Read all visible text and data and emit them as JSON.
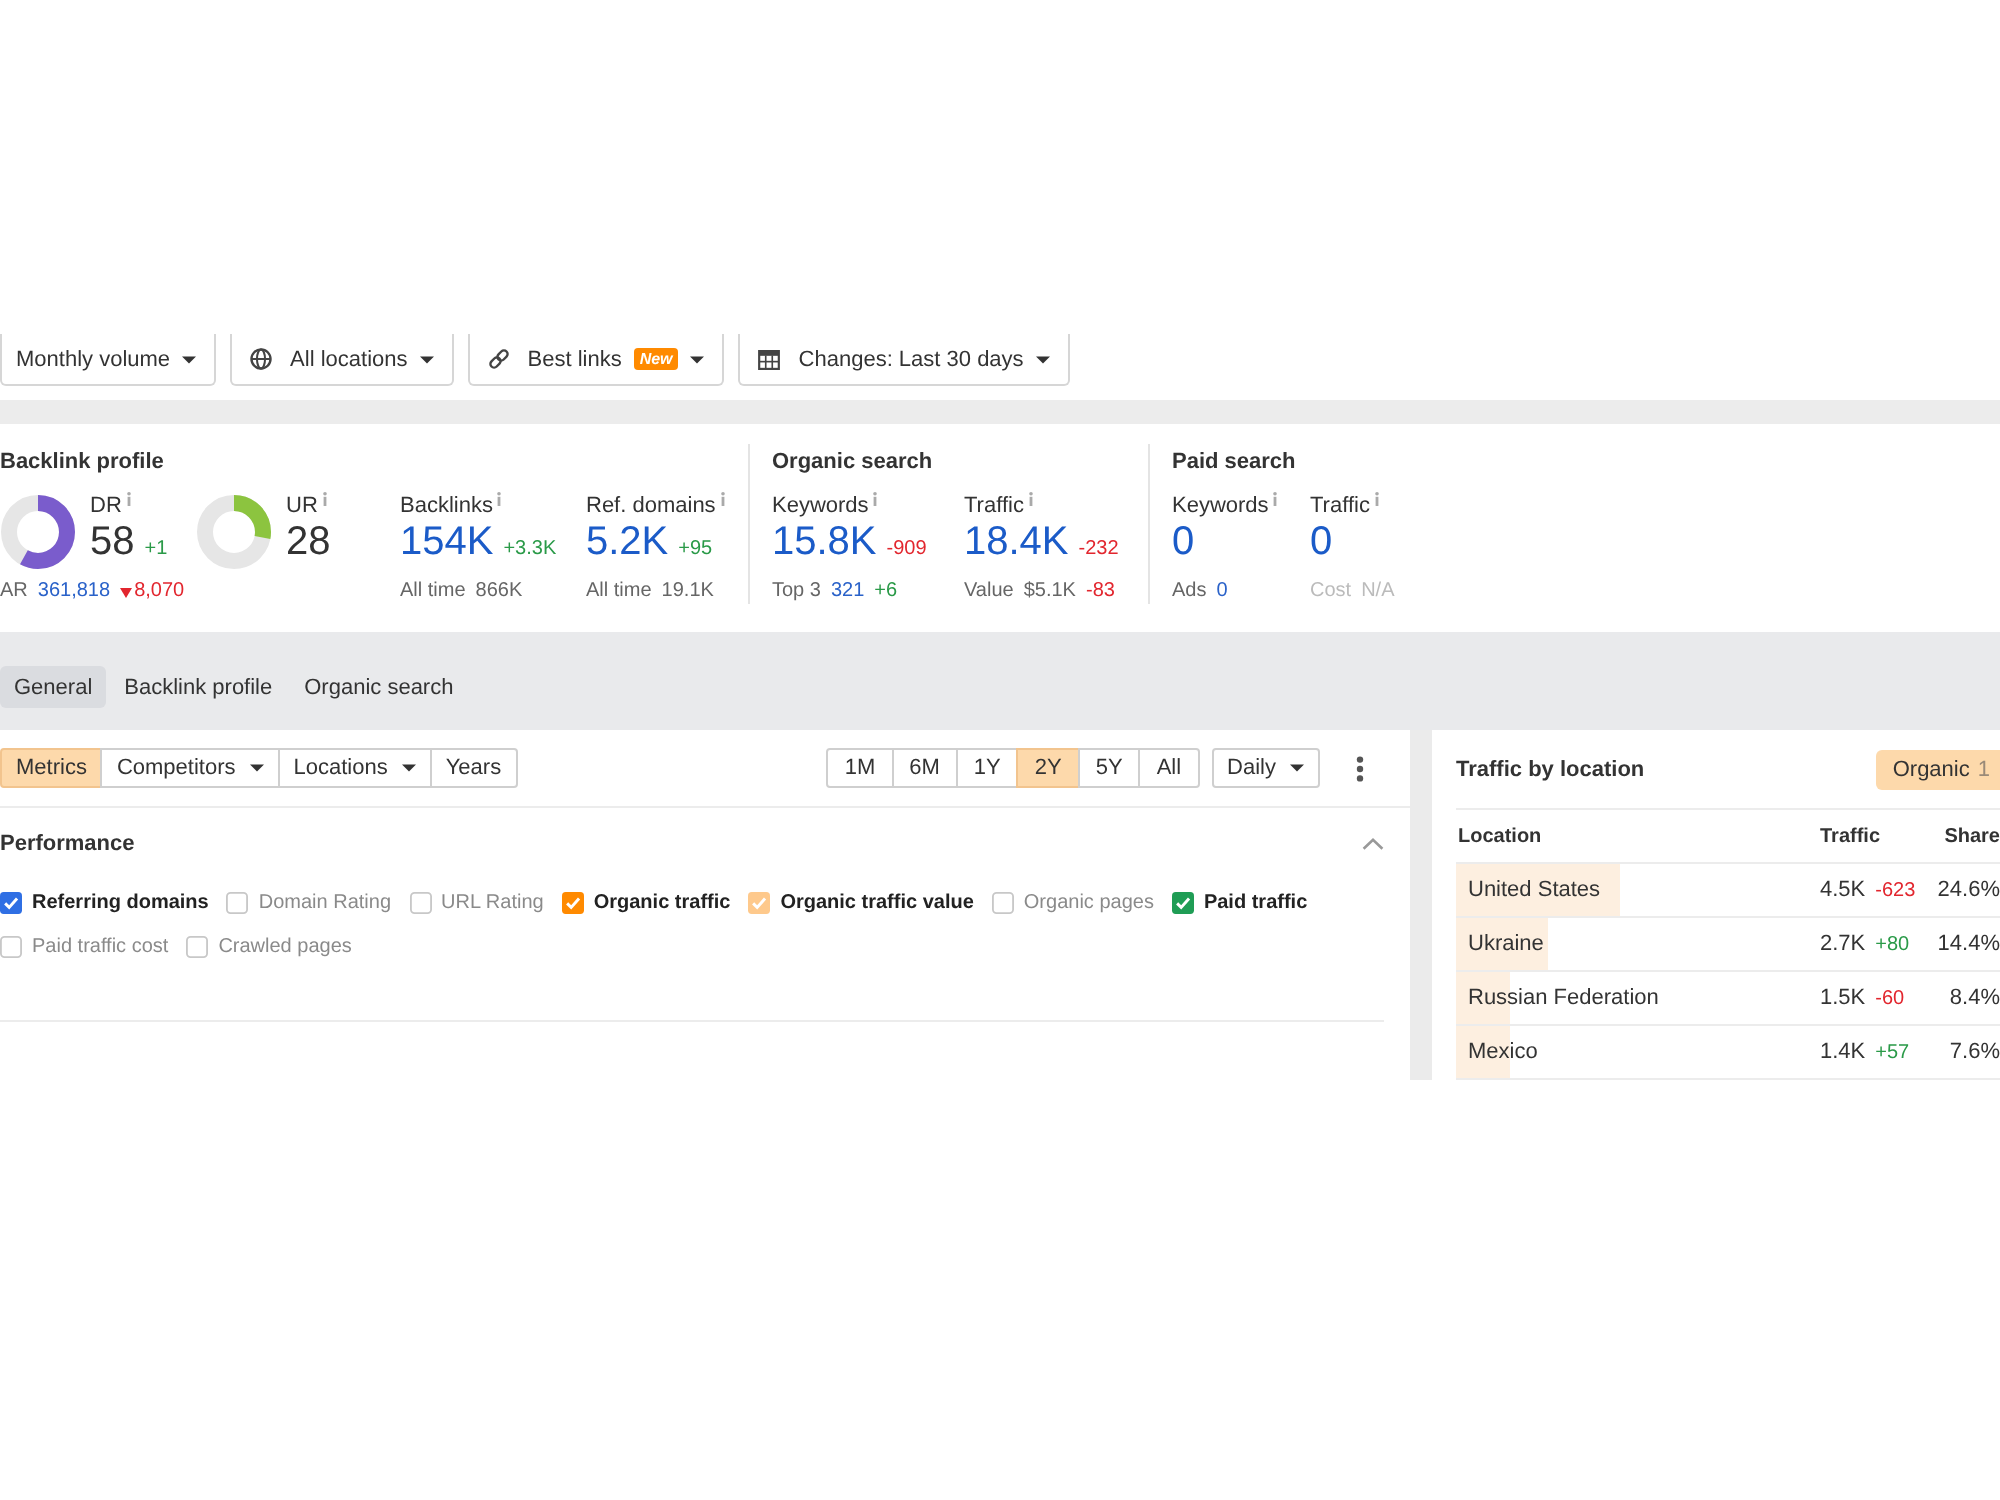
{
  "toolbar": [
    {
      "kind": "plain",
      "label": "Monthly volume"
    },
    {
      "kind": "location",
      "label": "All locations"
    },
    {
      "kind": "links",
      "label": "Best links",
      "badge": "New"
    },
    {
      "kind": "date",
      "label": "Changes: Last 30 days"
    }
  ],
  "overview": [
    {
      "title": "Backlink profile",
      "metrics": [
        {
          "kind": "rating",
          "label": "DR",
          "color": "#7a5ccc",
          "level": 0.58,
          "value": "58",
          "change": "+1",
          "positive": true,
          "details": [
            {
              "kind": "label",
              "text": "AR"
            },
            {
              "kind": "link",
              "text": "361,818"
            },
            {
              "kind": "drop",
              "text": "8,070"
            }
          ]
        },
        {
          "kind": "rating",
          "label": "UR",
          "color": "#8cc43f",
          "level": 0.28,
          "value": "28"
        },
        {
          "kind": "count",
          "label": "Backlinks",
          "value": "154K",
          "change": "+3.3K",
          "positive": true,
          "details": [
            {
              "kind": "label",
              "text": "All time"
            },
            {
              "kind": "label",
              "text": "866K"
            }
          ]
        },
        {
          "kind": "count",
          "label": "Ref. domains",
          "value": "5.2K",
          "change": "+95",
          "positive": true,
          "details": [
            {
              "kind": "label",
              "text": "All time"
            },
            {
              "kind": "label",
              "text": "19.1K"
            }
          ]
        }
      ]
    },
    {
      "title": "Organic search",
      "metrics": [
        {
          "kind": "count",
          "label": "Keywords",
          "value": "15.8K",
          "change": "-909",
          "positive": false,
          "details": [
            {
              "kind": "label",
              "text": "Top 3"
            },
            {
              "kind": "link",
              "text": "321"
            },
            {
              "kind": "up",
              "text": "+6"
            }
          ]
        },
        {
          "kind": "count",
          "label": "Traffic",
          "value": "18.4K",
          "change": "-232",
          "positive": false,
          "details": [
            {
              "kind": "label",
              "text": "Value"
            },
            {
              "kind": "label",
              "text": "$5.1K"
            },
            {
              "kind": "down",
              "text": "-83"
            }
          ]
        }
      ]
    },
    {
      "title": "Paid search",
      "metrics": [
        {
          "kind": "count",
          "label": "Keywords",
          "value": "0",
          "details": [
            {
              "kind": "label",
              "text": "Ads"
            },
            {
              "kind": "link",
              "text": "0"
            }
          ]
        },
        {
          "kind": "count",
          "label": "Traffic",
          "value": "0",
          "details": [
            {
              "kind": "disabled",
              "text": "Cost"
            },
            {
              "kind": "disabled",
              "text": "N/A"
            }
          ]
        }
      ]
    }
  ],
  "tabs": [
    {
      "label": "General",
      "selected": true
    },
    {
      "label": "Backlink profile",
      "selected": false
    },
    {
      "label": "Organic search",
      "selected": false
    }
  ],
  "chart_panel": {
    "filters": [
      {
        "label": "Metrics",
        "selected": true,
        "dropdown": false
      },
      {
        "label": "Competitors",
        "selected": false,
        "dropdown": true
      },
      {
        "label": "Locations",
        "selected": false,
        "dropdown": true
      },
      {
        "label": "Years",
        "selected": false,
        "dropdown": false
      }
    ],
    "periods": [
      {
        "label": "1M",
        "selected": false
      },
      {
        "label": "6M",
        "selected": false
      },
      {
        "label": "1Y",
        "selected": false
      },
      {
        "label": "2Y",
        "selected": true
      },
      {
        "label": "5Y",
        "selected": false
      },
      {
        "label": "All",
        "selected": false
      }
    ],
    "interval": "Daily",
    "performance": {
      "title": "Performance",
      "expanded": true,
      "series": [
        {
          "label": "Referring domains",
          "checked": true,
          "color": "#2f6fe4"
        },
        {
          "label": "Domain Rating",
          "checked": false
        },
        {
          "label": "URL Rating",
          "checked": false
        },
        {
          "label": "Organic traffic",
          "checked": true,
          "color": "#ff8a00"
        },
        {
          "label": "Organic traffic value",
          "checked": true,
          "color": "#fec98c"
        },
        {
          "label": "Organic pages",
          "checked": false
        },
        {
          "label": "Paid traffic",
          "checked": true,
          "color": "#1f9d55"
        },
        {
          "label": "Paid traffic cost",
          "checked": false
        },
        {
          "label": "Crawled pages",
          "checked": false
        }
      ]
    }
  },
  "traffic_by_location": {
    "title": "Traffic by location",
    "mode": {
      "label": "Organic",
      "count": "1"
    },
    "columns": [
      "Location",
      "Traffic",
      "Share"
    ],
    "rows": [
      {
        "location": "United States",
        "traffic": "4.5K",
        "change": "-623",
        "positive": false,
        "share": "24.6%",
        "level": 0.3
      },
      {
        "location": "Ukraine",
        "traffic": "2.7K",
        "change": "+80",
        "positive": true,
        "share": "14.4%",
        "level": 0.17
      },
      {
        "location": "Russian Federation",
        "traffic": "1.5K",
        "change": "-60",
        "positive": false,
        "share": "8.4%",
        "level": 0.1
      },
      {
        "location": "Mexico",
        "traffic": "1.4K",
        "change": "+57",
        "positive": true,
        "share": "7.6%",
        "level": 0.1
      }
    ]
  }
}
